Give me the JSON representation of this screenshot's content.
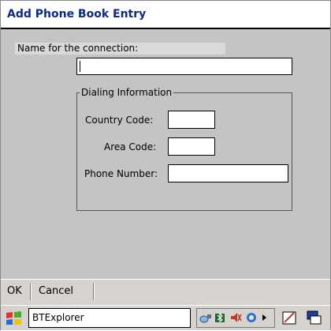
{
  "window": {
    "title": "Add Phone Book Entry"
  },
  "form": {
    "name_label": "Name for the connection:",
    "name_value": "",
    "dialing_group_label": "Dialing Information",
    "country_code_label": "Country Code:",
    "country_code_value": "",
    "area_code_label": "Area Code:",
    "area_code_value": "",
    "phone_number_label": "Phone Number:",
    "phone_number_value": ""
  },
  "command_bar": {
    "ok_label": "OK",
    "cancel_label": "Cancel"
  },
  "taskbar": {
    "start_icon": "windows-flag-icon",
    "active_task": "BTExplorer",
    "tray_icons": [
      "network-icon",
      "bluetooth-icon",
      "volume-icon",
      "sync-icon",
      "arrow-right-icon"
    ],
    "extra_icons": [
      "input-panel-icon",
      "desktop-icon"
    ]
  },
  "colors": {
    "title_text": "#0b2a84",
    "content_bg": "#c4c4c4",
    "bar_bg": "#d6d3ce"
  }
}
